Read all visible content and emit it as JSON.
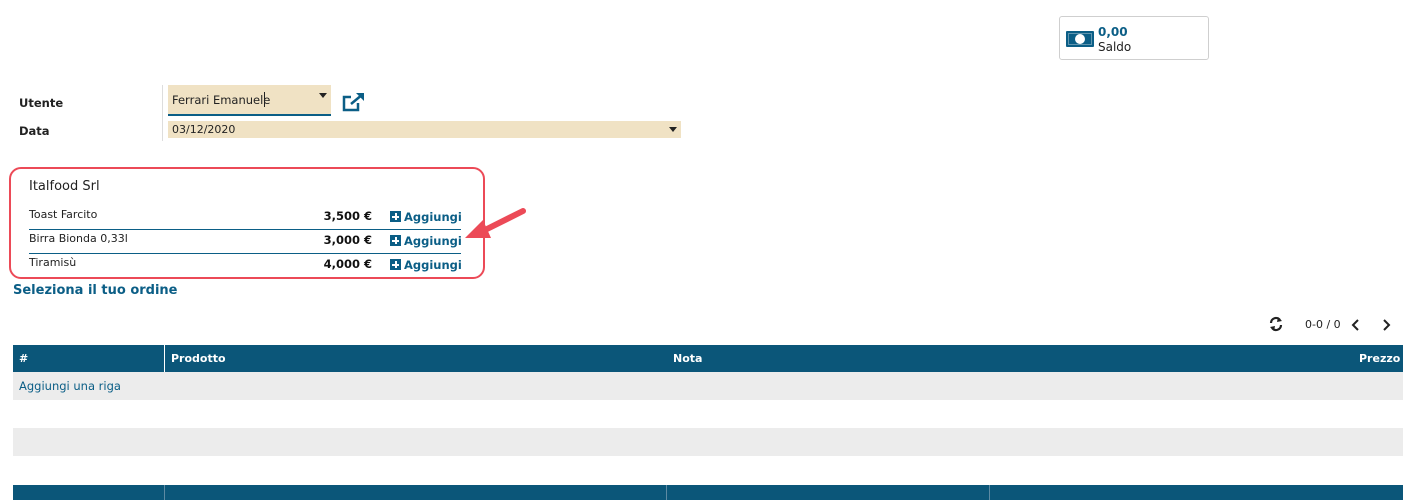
{
  "saldo": {
    "value": "0,00",
    "label": "Saldo",
    "icon": "money-bill-icon"
  },
  "form": {
    "user_label": "Utente",
    "user_value": "Ferrari Emanuele",
    "date_label": "Data",
    "date_value": "03/12/2020",
    "field_color": "#f0e2c4",
    "accent": "#0b5e86"
  },
  "vendor": {
    "name": "Italfood Srl",
    "highlight_color": "#ec4a57",
    "products": [
      {
        "name": "Toast Farcito",
        "price": "3,500 €",
        "action": "Aggiungi"
      },
      {
        "name": "Birra Bionda 0,33l",
        "price": "3,000 €",
        "action": "Aggiungi"
      },
      {
        "name": "Tiramisù",
        "price": "4,000 €",
        "action": "Aggiungi"
      }
    ]
  },
  "order": {
    "title": "Seleziona il tuo ordine",
    "pager": "0-0 / 0",
    "columns": [
      "#",
      "Prodotto",
      "Nota",
      "Prezzo"
    ],
    "add_row": "Aggiungi una riga",
    "header_color": "#0b5679"
  }
}
